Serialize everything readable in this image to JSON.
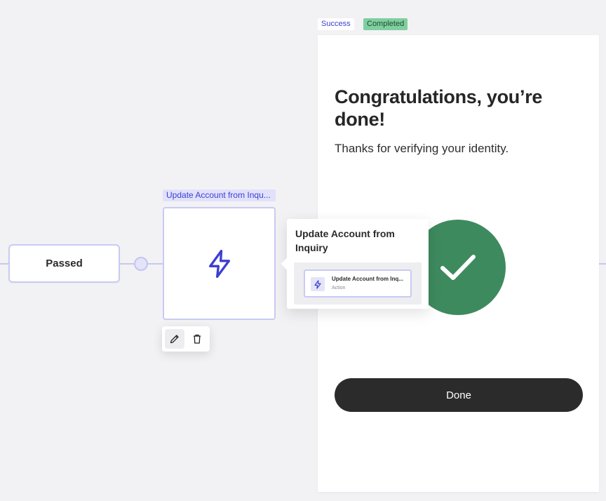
{
  "flow": {
    "passed_node": {
      "label": "Passed"
    },
    "action_node": {
      "tag": "Update Account from Inqu...",
      "icon": "lightning-icon"
    },
    "toolbar": {
      "edit_icon": "pencil-icon",
      "delete_icon": "trash-icon"
    },
    "popover": {
      "title": "Update Account from Inquiry",
      "mini_node": {
        "title": "Update Account from Inq...",
        "subtitle": "Action"
      }
    }
  },
  "screen": {
    "badges": {
      "success": "Success",
      "completed": "Completed"
    },
    "heading": "Congratulations, you’re done!",
    "subheading": "Thanks for verifying your identity.",
    "check_icon": "checkmark-icon",
    "done_button": "Done"
  },
  "colors": {
    "accent": "#3c3fcf",
    "node_border": "#c9caf3",
    "success_green": "#3e8a5f",
    "completed_badge": "#7fcf9f",
    "button_dark": "#2b2b2b"
  }
}
